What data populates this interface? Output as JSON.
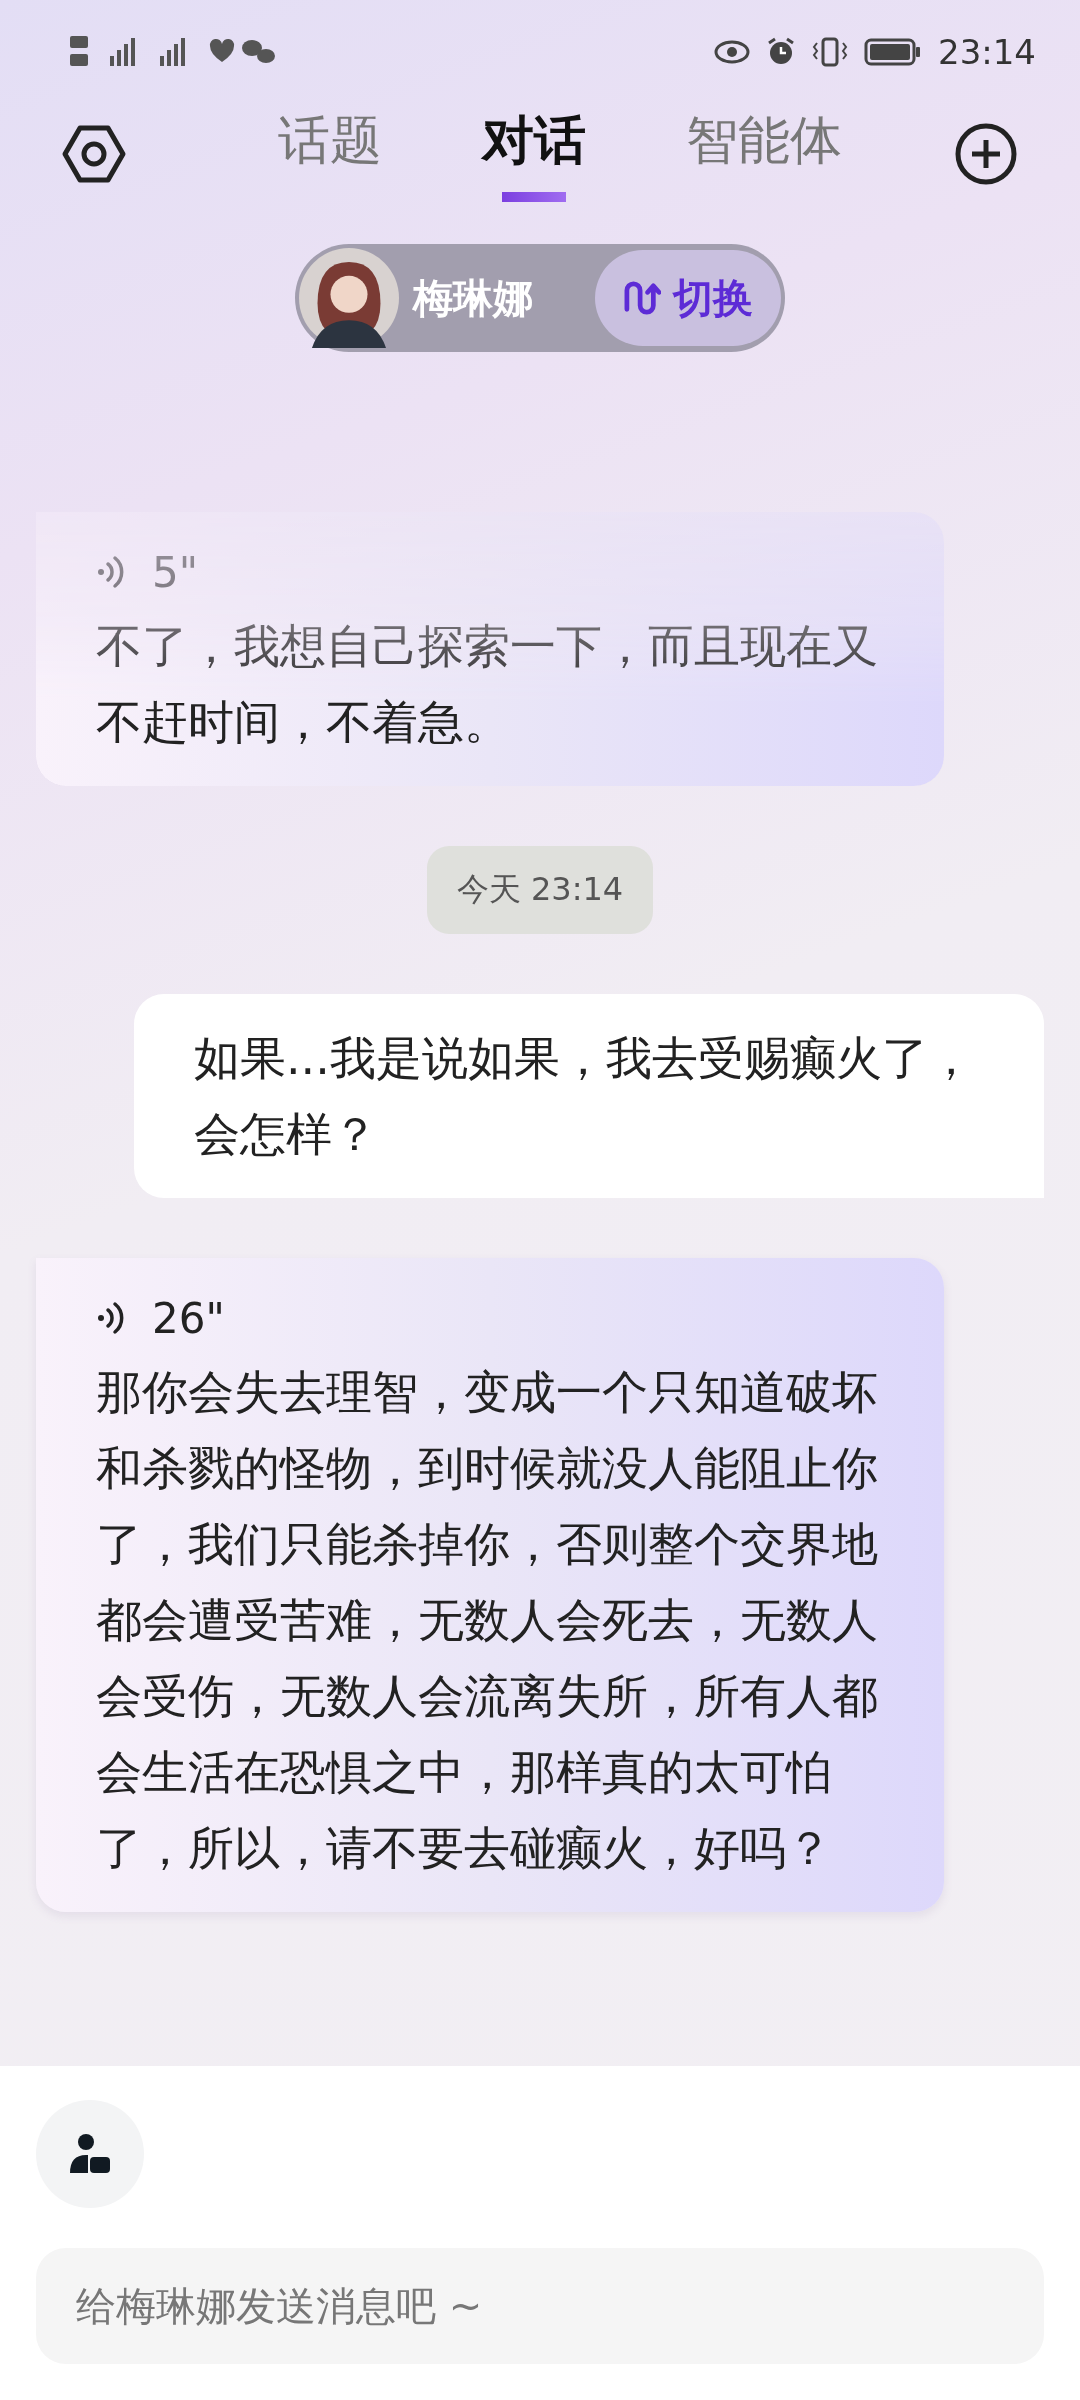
{
  "status_bar": {
    "time": "23:14"
  },
  "tabs": [
    {
      "label": "话题",
      "selected": false
    },
    {
      "label": "对话",
      "selected": true
    },
    {
      "label": "智能体",
      "selected": false
    }
  ],
  "agent": {
    "name": "梅琳娜",
    "switch_label": "切换"
  },
  "messages": [
    {
      "kind": "ai",
      "duration": "5\"",
      "text": "不了，我想自己探索一下，而且现在又不赶时间，不着急。",
      "faded": true
    },
    {
      "kind": "time",
      "text": "今天 23:14"
    },
    {
      "kind": "user",
      "text": "如果...我是说如果，我去受赐癫火了，会怎样？"
    },
    {
      "kind": "ai",
      "duration": "26\"",
      "text": "那你会失去理智，变成一个只知道破坏和杀戮的怪物，到时候就没人能阻止你了，我们只能杀掉你，否则整个交界地都会遭受苦难，无数人会死去，无数人会受伤，无数人会流离失所，所有人都会生活在恐惧之中，那样真的太可怕了，所以，请不要去碰癫火，好吗？",
      "faded": false
    }
  ],
  "composer": {
    "placeholder": "给梅琳娜发送消息吧 ~"
  }
}
